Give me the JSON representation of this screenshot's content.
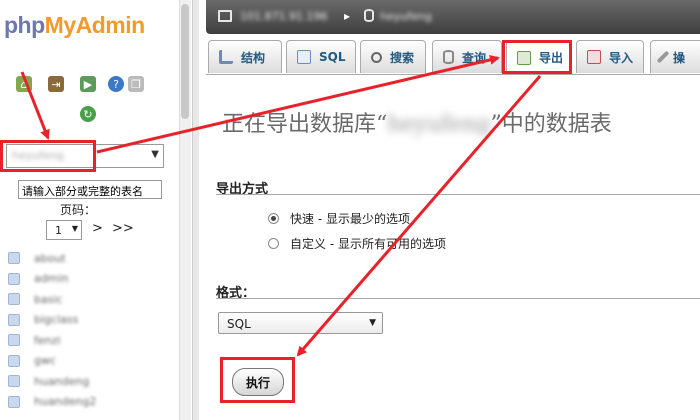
{
  "logo": {
    "php": "php",
    "rest": "MyAdmin"
  },
  "navigation": {
    "database_select": {
      "value": "heyufeng"
    },
    "filter_placeholder": "请输入部分或完整的表名",
    "page_label": "页码：",
    "page_value": "1",
    "next": ">",
    "last": ">>",
    "tables": [
      "about",
      "admin",
      "basic",
      "bigclass",
      "fenzi",
      "gwc",
      "huandeng",
      "huandeng2"
    ]
  },
  "breadcrumb": {
    "server": "101.871.91.196",
    "separator": "▸",
    "database": "heyufeng"
  },
  "tabs": [
    {
      "label": "结构",
      "icon": "structure-icon"
    },
    {
      "label": "SQL",
      "icon": "sql-icon"
    },
    {
      "label": "搜索",
      "icon": "search-icon"
    },
    {
      "label": "查询",
      "icon": "query-icon"
    },
    {
      "label": "导出",
      "icon": "export-icon",
      "active": true
    },
    {
      "label": "导入",
      "icon": "import-icon"
    },
    {
      "label": "操",
      "icon": "operations-icon"
    }
  ],
  "main": {
    "title_prefix": "正在导出数据库“",
    "title_db": "heyufeng",
    "title_suffix": "”中的数据表",
    "export_method_legend": "导出方式",
    "options": [
      {
        "label": "快速 - 显示最少的选项",
        "checked": true
      },
      {
        "label": "自定义 - 显示所有可用的选项",
        "checked": false
      }
    ],
    "format_legend": "格式：",
    "format_value": "SQL",
    "go_button": "执行"
  },
  "colors": {
    "annotation": "#e8222b",
    "link": "#235a81",
    "logo_php": "#6c78af",
    "logo_myadmin": "#f29a2b"
  }
}
